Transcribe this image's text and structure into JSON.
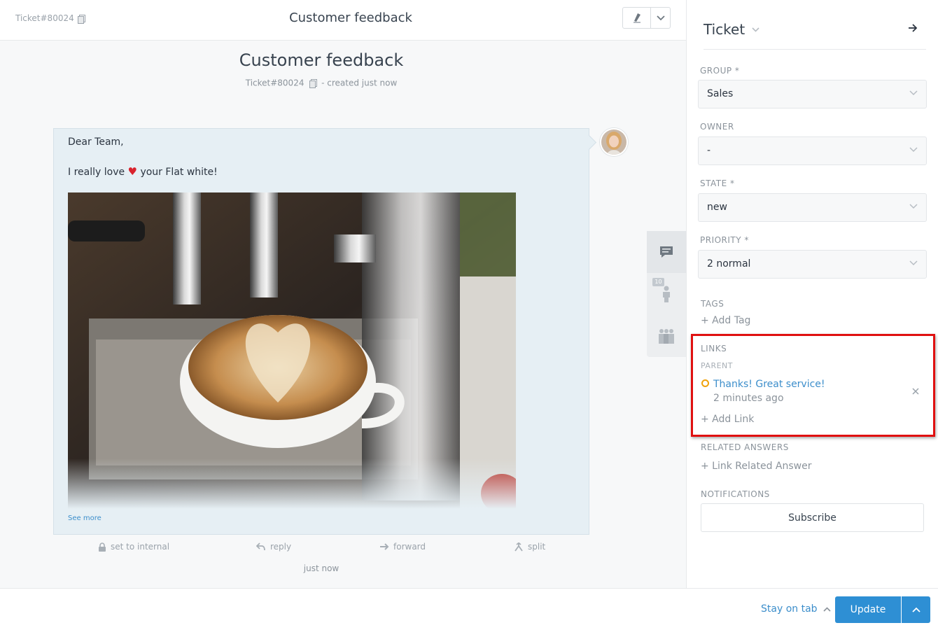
{
  "topbar": {
    "ticket_number": "Ticket#80024",
    "title": "Customer feedback"
  },
  "ticket": {
    "title": "Customer feedback",
    "number": "Ticket#80024",
    "created": "- created just now"
  },
  "article": {
    "greeting": "Dear Team,",
    "line_before": "I really love",
    "line_after": "your Flat white!",
    "see_more": "See more",
    "time": "just now",
    "actions": {
      "internal": "set to internal",
      "reply": "reply",
      "forward": "forward",
      "split": "split"
    }
  },
  "side_tabs": {
    "customer_badge": "10"
  },
  "sidebar": {
    "title": "Ticket",
    "fields": {
      "group": {
        "label": "GROUP *",
        "value": "Sales"
      },
      "owner": {
        "label": "OWNER",
        "value": "-"
      },
      "state": {
        "label": "STATE *",
        "value": "new"
      },
      "priority": {
        "label": "PRIORITY *",
        "value": "2 normal"
      }
    },
    "tags": {
      "label": "TAGS",
      "add": "+ Add Tag"
    },
    "links": {
      "label": "LINKS",
      "parent_label": "PARENT",
      "items": [
        {
          "title": "Thanks! Great service!",
          "time": "2 minutes ago",
          "status_color": "#f0a20b"
        }
      ],
      "add": "+ Add Link"
    },
    "related": {
      "label": "RELATED ANSWERS",
      "add": "+ Link Related Answer"
    },
    "notifications": {
      "label": "NOTIFICATIONS",
      "subscribe": "Subscribe"
    }
  },
  "bottombar": {
    "stay_on_tab": "Stay on tab",
    "update": "Update"
  },
  "colors": {
    "accent": "#2e8fd4",
    "link": "#3c8ecb",
    "highlight": "#e01010",
    "article_bg": "#e6eff4"
  }
}
